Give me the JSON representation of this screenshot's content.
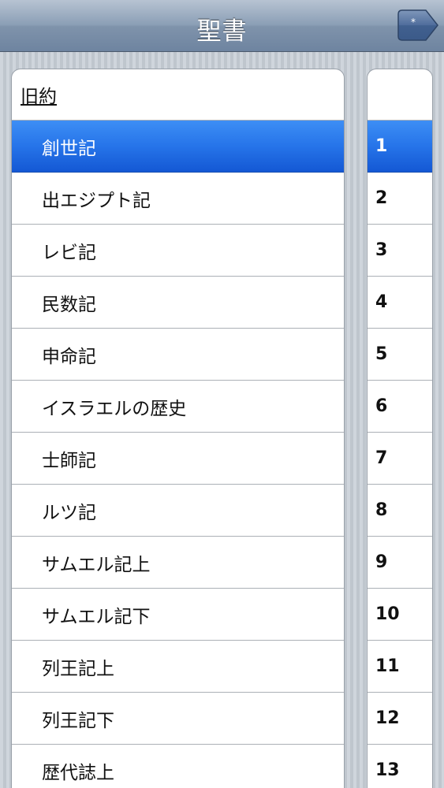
{
  "navbar": {
    "title": "聖書",
    "right_button_label": "*"
  },
  "books": {
    "section_header": "旧約",
    "selected_index": 0,
    "items": [
      "創世記",
      "出エジプト記",
      "レビ記",
      "民数記",
      "申命記",
      "イスラエルの歴史",
      "士師記",
      "ルツ記",
      "サムエル記上",
      "サムエル記下",
      "列王記上",
      "列王記下",
      "歴代誌上"
    ]
  },
  "chapters": {
    "header": "",
    "selected_index": 0,
    "items": [
      "1",
      "2",
      "3",
      "4",
      "5",
      "6",
      "7",
      "8",
      "9",
      "10",
      "11",
      "12",
      "13"
    ]
  },
  "colors": {
    "selection": "#2674e9",
    "navbar": "#8b9fb6",
    "background": "#c5ccd4"
  }
}
